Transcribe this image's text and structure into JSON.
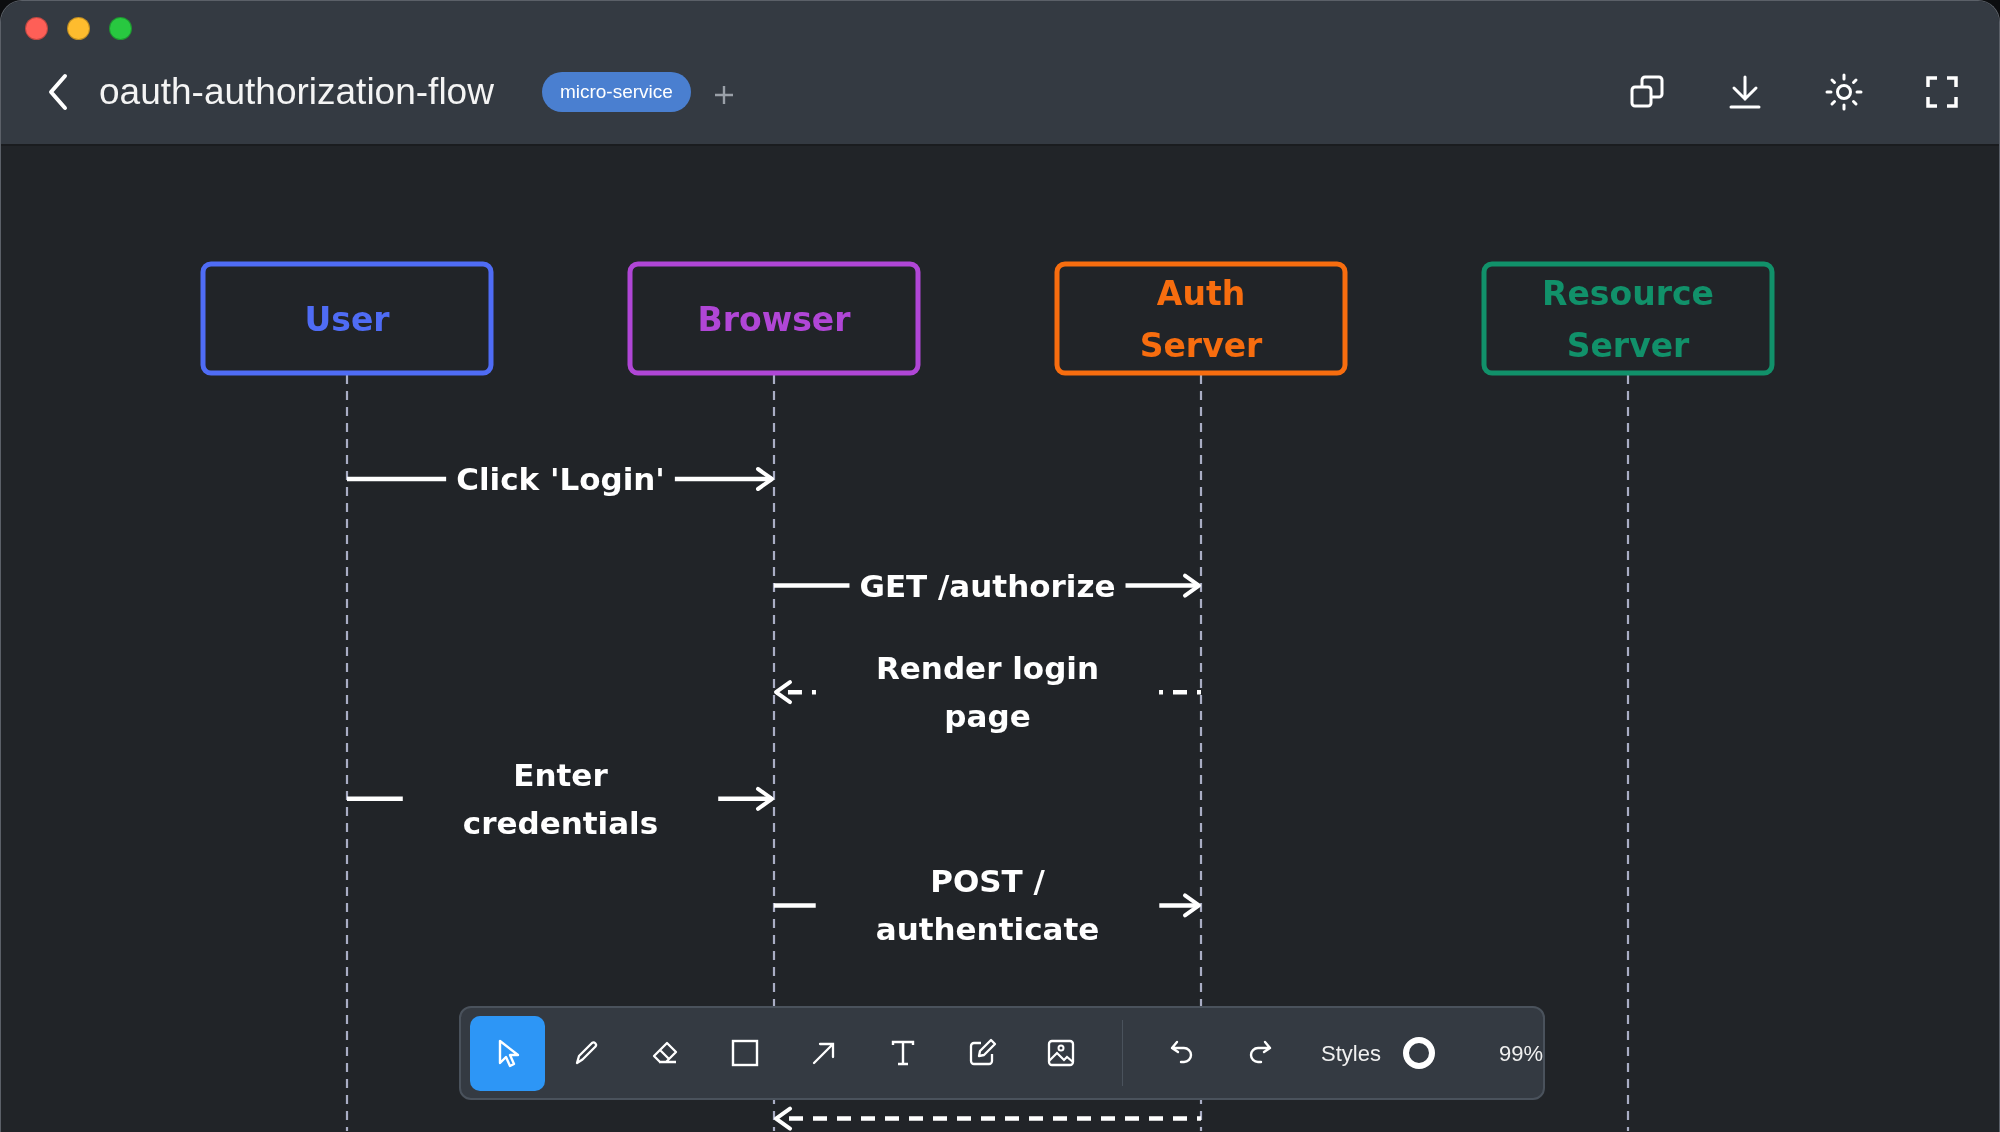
{
  "window": {
    "title": "oauth-authorization-flow",
    "tag": "micro-service"
  },
  "participants": [
    {
      "name": "User",
      "color": "#4f6cf5"
    },
    {
      "name": "Browser",
      "color": "#b046d6"
    },
    {
      "name": "Auth Server",
      "color": "#f76d0f"
    },
    {
      "name": "Resource Server",
      "color": "#11916a"
    }
  ],
  "messages": [
    {
      "label_lines": [
        "Click 'Login'"
      ],
      "points_right": true,
      "kind": "ab-request"
    },
    {
      "label_lines": [
        "GET /authorize"
      ],
      "points_right": true,
      "kind": "bc-request"
    },
    {
      "label_lines": [
        "Render login",
        "page"
      ],
      "points_right": false,
      "kind": "bc-response"
    },
    {
      "label_lines": [
        "Enter",
        "credentials"
      ],
      "points_right": true,
      "kind": "ab-request"
    },
    {
      "label_lines": [
        "POST /",
        "authenticate"
      ],
      "points_right": true,
      "kind": "bc-request"
    },
    {
      "points_right": false,
      "kind": "bc-response",
      "after_hidden_row": true
    }
  ],
  "toolbar": {
    "tools": [
      {
        "kind": "select",
        "selected": true
      },
      {
        "kind": "pencil",
        "selected": false
      },
      {
        "kind": "eraser",
        "selected": false
      },
      {
        "kind": "rectangle",
        "selected": false
      },
      {
        "kind": "arrow",
        "selected": false
      },
      {
        "kind": "text",
        "selected": false
      },
      {
        "kind": "note",
        "selected": false
      },
      {
        "kind": "image",
        "selected": false
      }
    ],
    "styles_label": "Styles",
    "zoom": "99%"
  }
}
